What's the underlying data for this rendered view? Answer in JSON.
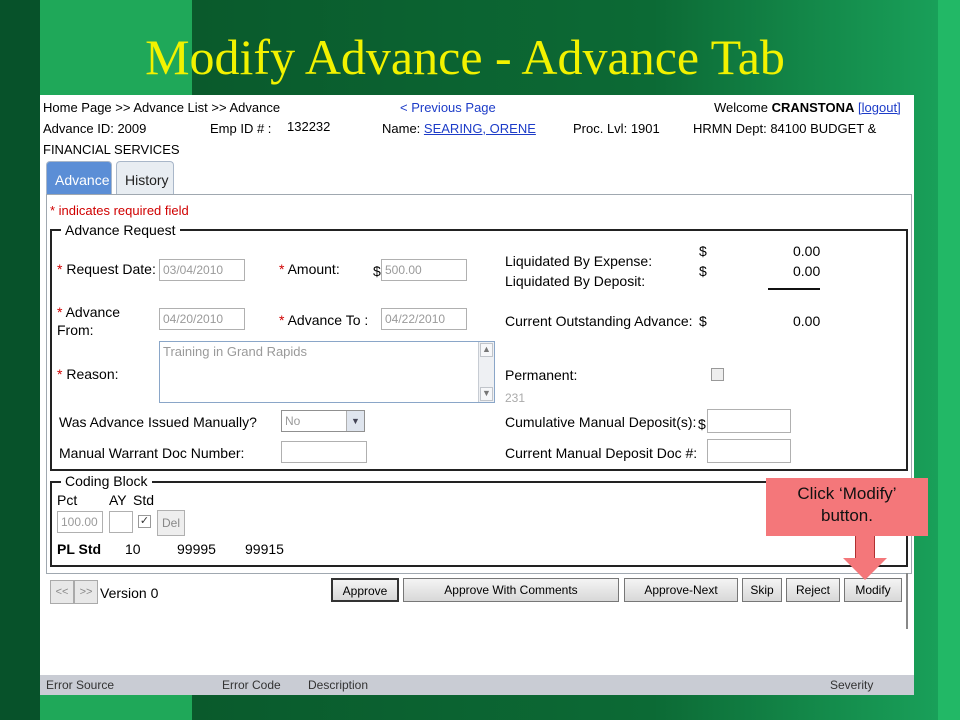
{
  "slide": {
    "title": "Modify Advance - Advance Tab"
  },
  "header": {
    "breadcrumb": "Home Page >> Advance List >> Advance",
    "prev_page": "< Previous Page",
    "welcome": "Welcome",
    "user": "CRANSTONA",
    "logout": "[logout]",
    "advance_id_label": "Advance ID:",
    "advance_id": "2009",
    "emp_id_label": "Emp ID # :",
    "emp_id": "132232",
    "name_label": "Name:",
    "name": "SEARING, ORENE",
    "proc_lvl_label": "Proc. Lvl:",
    "proc_lvl": "1901",
    "dept_label": "HRMN Dept:",
    "dept": "84100 BUDGET &",
    "dept_cont": "FINANCIAL SERVICES"
  },
  "tabs": [
    {
      "label": "Advance"
    },
    {
      "label": "History"
    }
  ],
  "form": {
    "required_note": "* indicates required field",
    "advance_request_legend": "Advance Request",
    "request_date_label": "Request Date:",
    "request_date": "03/04/2010",
    "amount_label": "Amount:",
    "amount_currency": "$",
    "amount": "500.00",
    "advance_from_label": "Advance",
    "advance_from_label2": "From:",
    "advance_from": "04/20/2010",
    "advance_to_label": "Advance To :",
    "advance_to": "04/22/2010",
    "reason_label": "Reason:",
    "reason": "Training in Grand Rapids",
    "char_count": "231",
    "issued_manually_label": "Was Advance Issued Manually?",
    "issued_manually": "No",
    "warrant_doc_label": "Manual Warrant Doc Number:",
    "liquidated_expense_label": "Liquidated By Expense:",
    "liquidated_expense_currency": "$",
    "liquidated_expense": "0.00",
    "liquidated_deposit_label": "Liquidated By Deposit:",
    "liquidated_deposit_currency": "$",
    "liquidated_deposit": "0.00",
    "outstanding_label": "Current Outstanding Advance:",
    "outstanding_currency": "$",
    "outstanding": "0.00",
    "permanent_label": "Permanent:",
    "cum_deposit_label": "Cumulative Manual Deposit(s):",
    "cum_deposit_currency": "$",
    "deposit_doc_label": "Current Manual Deposit Doc #:",
    "req_star": "*"
  },
  "coding": {
    "legend": "Coding Block",
    "pct_label": "Pct",
    "ay_label": "AY",
    "std_label": "Std",
    "pct": "100.00",
    "std_check": "✓",
    "del_label": "Del",
    "pl_std_label": "PL Std",
    "pl_values": [
      "10",
      "99995",
      "99915"
    ]
  },
  "footer": {
    "prev_btn": "<<",
    "next_btn": ">>",
    "version": "Version 0",
    "buttons": {
      "approve": "Approve",
      "approve_comments": "Approve With Comments",
      "approve_next": "Approve-Next",
      "skip": "Skip",
      "reject": "Reject",
      "modify": "Modify"
    }
  },
  "errors": {
    "source": "Error Source",
    "code": "Error Code",
    "description": "Description",
    "severity": "Severity"
  },
  "callout": {
    "line1": "Click ‘Modify’",
    "line2": "button."
  },
  "colors": {
    "title": "#f2f200",
    "link": "#1d3cc8",
    "required": "#d00000",
    "callout": "#f4777a",
    "active_tab": "#5b8ed6"
  }
}
